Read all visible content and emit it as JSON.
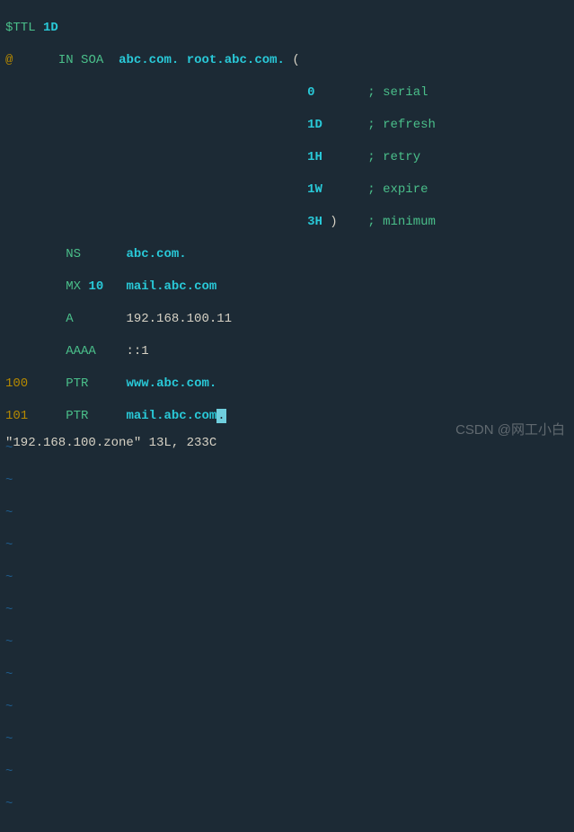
{
  "line1": {
    "ttl": "$TTL",
    "val": "1D"
  },
  "line2": {
    "at": "@",
    "in": "IN",
    "type": "SOA",
    "ns": "abc.com.",
    "mail": "root.abc.com.",
    "paren": "("
  },
  "line3": {
    "val": "0",
    "comment": "; serial"
  },
  "line4": {
    "val": "1D",
    "comment": "; refresh"
  },
  "line5": {
    "val": "1H",
    "comment": "; retry"
  },
  "line6": {
    "val": "1W",
    "comment": "; expire"
  },
  "line7": {
    "val": "3H",
    "paren": ")",
    "comment": "; minimum"
  },
  "line8": {
    "type": "NS",
    "val": "abc.com."
  },
  "line9": {
    "type": "MX",
    "pref": "10",
    "val": "mail.abc.com"
  },
  "line10": {
    "type": "A",
    "val": "192.168.100.11"
  },
  "line11": {
    "type": "AAAA",
    "val": "::1"
  },
  "line12": {
    "name": "100",
    "type": "PTR",
    "val": "www.abc.com."
  },
  "line13": {
    "name": "101",
    "type": "PTR",
    "val": "mail.abc.com",
    "cursor": "."
  },
  "tilde": "~",
  "status": "\"192.168.100.zone\" 13L, 233C",
  "watermark": "CSDN @网工小白"
}
